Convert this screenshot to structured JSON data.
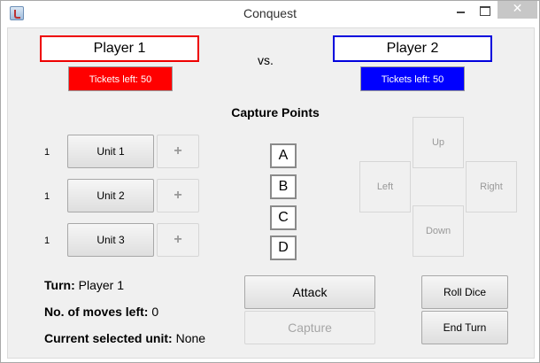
{
  "window": {
    "title": "Conquest"
  },
  "players": {
    "p1": {
      "name": "Player 1",
      "tickets": "Tickets left: 50",
      "color": "#ff0000"
    },
    "p2": {
      "name": "Player 2",
      "tickets": "Tickets left: 50",
      "color": "#0000ff"
    },
    "vs": "vs."
  },
  "capture_points": {
    "title": "Capture Points",
    "points": [
      "A",
      "B",
      "C",
      "D"
    ]
  },
  "units": [
    {
      "count": "1",
      "label": "Unit 1",
      "add": "+"
    },
    {
      "count": "1",
      "label": "Unit 2",
      "add": "+"
    },
    {
      "count": "1",
      "label": "Unit 3",
      "add": "+"
    }
  ],
  "directions": {
    "up": "Up",
    "left": "Left",
    "right": "Right",
    "down": "Down"
  },
  "actions": {
    "attack": "Attack",
    "capture": "Capture",
    "roll_dice": "Roll Dice",
    "end_turn": "End Turn"
  },
  "status": {
    "turn_label": "Turn:",
    "turn_value": "Player 1",
    "moves_label": "No. of moves left:",
    "moves_value": "0",
    "unit_label": "Current selected unit:",
    "unit_value": "None"
  }
}
